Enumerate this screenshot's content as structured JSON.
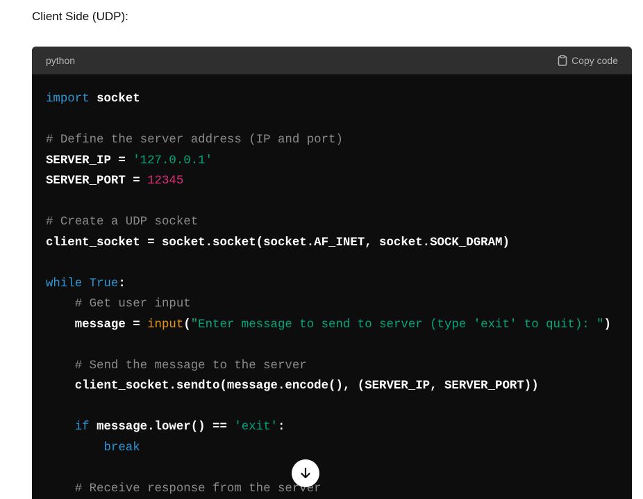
{
  "heading": "Client Side (UDP):",
  "code_block": {
    "language": "python",
    "copy_label": "Copy code",
    "lines": [
      [
        [
          "kw",
          "import "
        ],
        [
          "id",
          "socket"
        ]
      ],
      [],
      [
        [
          "cm",
          "# Define the server address (IP and port)"
        ]
      ],
      [
        [
          "id",
          "SERVER_IP = "
        ],
        [
          "st",
          "'127.0.0.1'"
        ]
      ],
      [
        [
          "id",
          "SERVER_PORT = "
        ],
        [
          "nm",
          "12345"
        ]
      ],
      [],
      [
        [
          "cm",
          "# Create a UDP socket"
        ]
      ],
      [
        [
          "id",
          "client_socket = socket.socket(socket.AF_INET, socket.SOCK_DGRAM)"
        ]
      ],
      [],
      [
        [
          "kw",
          "while "
        ],
        [
          "kw",
          "True"
        ],
        [
          "id",
          ":"
        ]
      ],
      [
        [
          "id",
          "    "
        ],
        [
          "cm",
          "# Get user input"
        ]
      ],
      [
        [
          "id",
          "    message = "
        ],
        [
          "fn",
          "input"
        ],
        [
          "id",
          "("
        ],
        [
          "st",
          "\"Enter message to send to server (type 'exit' to quit): \""
        ],
        [
          "id",
          ")"
        ]
      ],
      [],
      [
        [
          "id",
          "    "
        ],
        [
          "cm",
          "# Send the message to the server"
        ]
      ],
      [
        [
          "id",
          "    client_socket.sendto(message.encode(), (SERVER_IP, SERVER_PORT))"
        ]
      ],
      [],
      [
        [
          "id",
          "    "
        ],
        [
          "kw",
          "if "
        ],
        [
          "id",
          "message.lower() == "
        ],
        [
          "st",
          "'exit'"
        ],
        [
          "id",
          ":"
        ]
      ],
      [
        [
          "id",
          "        "
        ],
        [
          "kw",
          "break"
        ]
      ],
      [],
      [
        [
          "id",
          "    "
        ],
        [
          "cm",
          "# Receive response from the server"
        ]
      ]
    ]
  },
  "scroll_down_icon": "arrow-down-icon"
}
